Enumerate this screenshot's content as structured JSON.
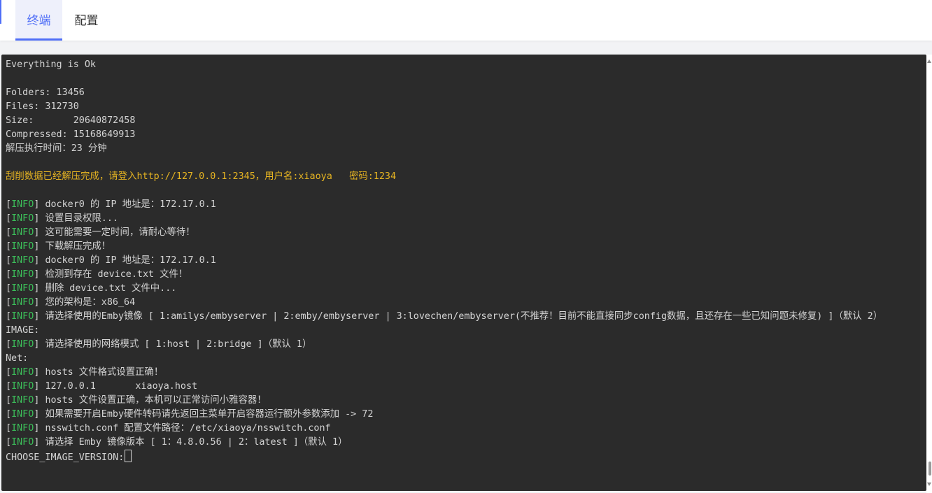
{
  "tabs": [
    {
      "label": "终端",
      "active": true
    },
    {
      "label": "配置",
      "active": false
    }
  ],
  "colors": {
    "accent": "#4f6ef7",
    "terminal_bg": "#2b2b2b",
    "terminal_text": "#d4d4d4",
    "highlight_yellow": "#e6b422",
    "info_green": "#3cbf5a"
  },
  "terminal": {
    "lines": [
      {
        "text": "Everything is Ok"
      },
      {
        "text": ""
      },
      {
        "text": "Folders: 13456"
      },
      {
        "text": "Files: 312730"
      },
      {
        "text": "Size:       20640872458"
      },
      {
        "text": "Compressed: 15168649913"
      },
      {
        "text": "解压执行时间：23 分钟"
      },
      {
        "text": ""
      },
      {
        "text": "刮削数据已经解压完成，请登入http://127.0.0.1:2345，用户名:xiaoya   密码:1234",
        "color": "yellow"
      },
      {
        "text": ""
      },
      {
        "tag": "INFO",
        "text": "docker0 的 IP 地址是：172.17.0.1"
      },
      {
        "tag": "INFO",
        "text": "设置目录权限..."
      },
      {
        "tag": "INFO",
        "text": "这可能需要一定时间，请耐心等待！"
      },
      {
        "tag": "INFO",
        "text": "下载解压完成！"
      },
      {
        "tag": "INFO",
        "text": "docker0 的 IP 地址是：172.17.0.1"
      },
      {
        "tag": "INFO",
        "text": "检测到存在 device.txt 文件！"
      },
      {
        "tag": "INFO",
        "text": "删除 device.txt 文件中..."
      },
      {
        "tag": "INFO",
        "text": "您的架构是：x86_64"
      },
      {
        "tag": "INFO",
        "text": "请选择使用的Emby镜像 [ 1:amilys/embyserver | 2:emby/embyserver | 3:lovechen/embyserver(不推荐！目前不能直接同步config数据，且还存在一些已知问题未修复) ]（默认 2）"
      },
      {
        "text": "IMAGE:"
      },
      {
        "tag": "INFO",
        "text": "请选择使用的网络模式 [ 1:host | 2:bridge ]（默认 1）"
      },
      {
        "text": "Net:"
      },
      {
        "tag": "INFO",
        "text": "hosts 文件格式设置正确！"
      },
      {
        "tag": "INFO",
        "text": "127.0.0.1       xiaoya.host"
      },
      {
        "tag": "INFO",
        "text": "hosts 文件设置正确，本机可以正常访问小雅容器！"
      },
      {
        "tag": "INFO",
        "text": "如果需要开启Emby硬件转码请先返回主菜单开启容器运行额外参数添加 -> 72"
      },
      {
        "tag": "INFO",
        "text": "nsswitch.conf 配置文件路径：/etc/xiaoya/nsswitch.conf"
      },
      {
        "tag": "INFO",
        "text": "请选择 Emby 镜像版本 [ 1：4.8.0.56 | 2：latest ]（默认 1）"
      },
      {
        "text": "CHOOSE_IMAGE_VERSION:",
        "cursor": true
      }
    ]
  }
}
